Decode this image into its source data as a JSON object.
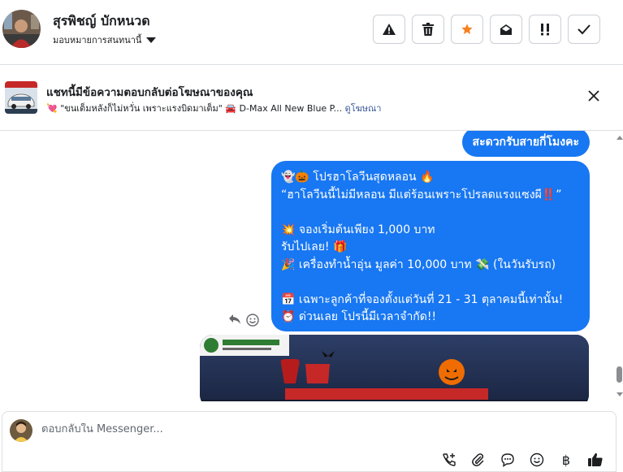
{
  "header": {
    "name": "สุรพิชญ์ บักหนวด",
    "assign_label": "มอบหมายการสนทนานี้",
    "action_icons": [
      "warning-icon",
      "trash-icon",
      "star-icon",
      "envelope-open-icon",
      "double-exclamation-icon",
      "check-icon"
    ]
  },
  "ad": {
    "title": "แชทนี้มีข้อความตอบกลับต่อโฆษณาของคุณ",
    "subtitle_text": "\"ขนเต็มหลังก็ไม่หวั่น เพราะแรงบิดมาเต็ม\" 🚘 D-Max All New Blue P...",
    "subtitle_emoji": "💘",
    "link": "ดูโฆษณา"
  },
  "chat": {
    "small_bubble": "สะดวกรับสายกี่โมงคะ",
    "main_bubble_lines": [
      "👻🎃 โปรฮาโลวีนสุดหลอน 🔥",
      "“ฮาโลวีนนี้ไม่มีหลอน มีแต่ร้อนเพราะโปรลดแรงแซงผี‼️”",
      "",
      "💥 จองเริ่มต้นเพียง 1,000 บาท",
      "รับไปเลย! 🎁",
      "🎉 เครื่องทำน้ำอุ่น มูลค่า 10,000 บาท 💸 (ในวันรับรถ)",
      "",
      "📅 เฉพาะลูกค้าที่จองตั้งแต่วันที่ 21 - 31 ตุลาคมนี้เท่านั้น!",
      "⏰ ด่วนเลย โปรนี้มีเวลาจำกัด!!"
    ]
  },
  "composer": {
    "placeholder": "ตอบกลับใน Messenger...",
    "tools": [
      "call-add-icon",
      "paperclip-icon",
      "chat-bubble-icon",
      "emoji-icon",
      "baht-icon",
      "thumbs-up-icon"
    ],
    "baht_glyph": "฿"
  },
  "colors": {
    "accent": "#1877f2",
    "border": "#dddfe2",
    "orange": "#f5821f"
  }
}
